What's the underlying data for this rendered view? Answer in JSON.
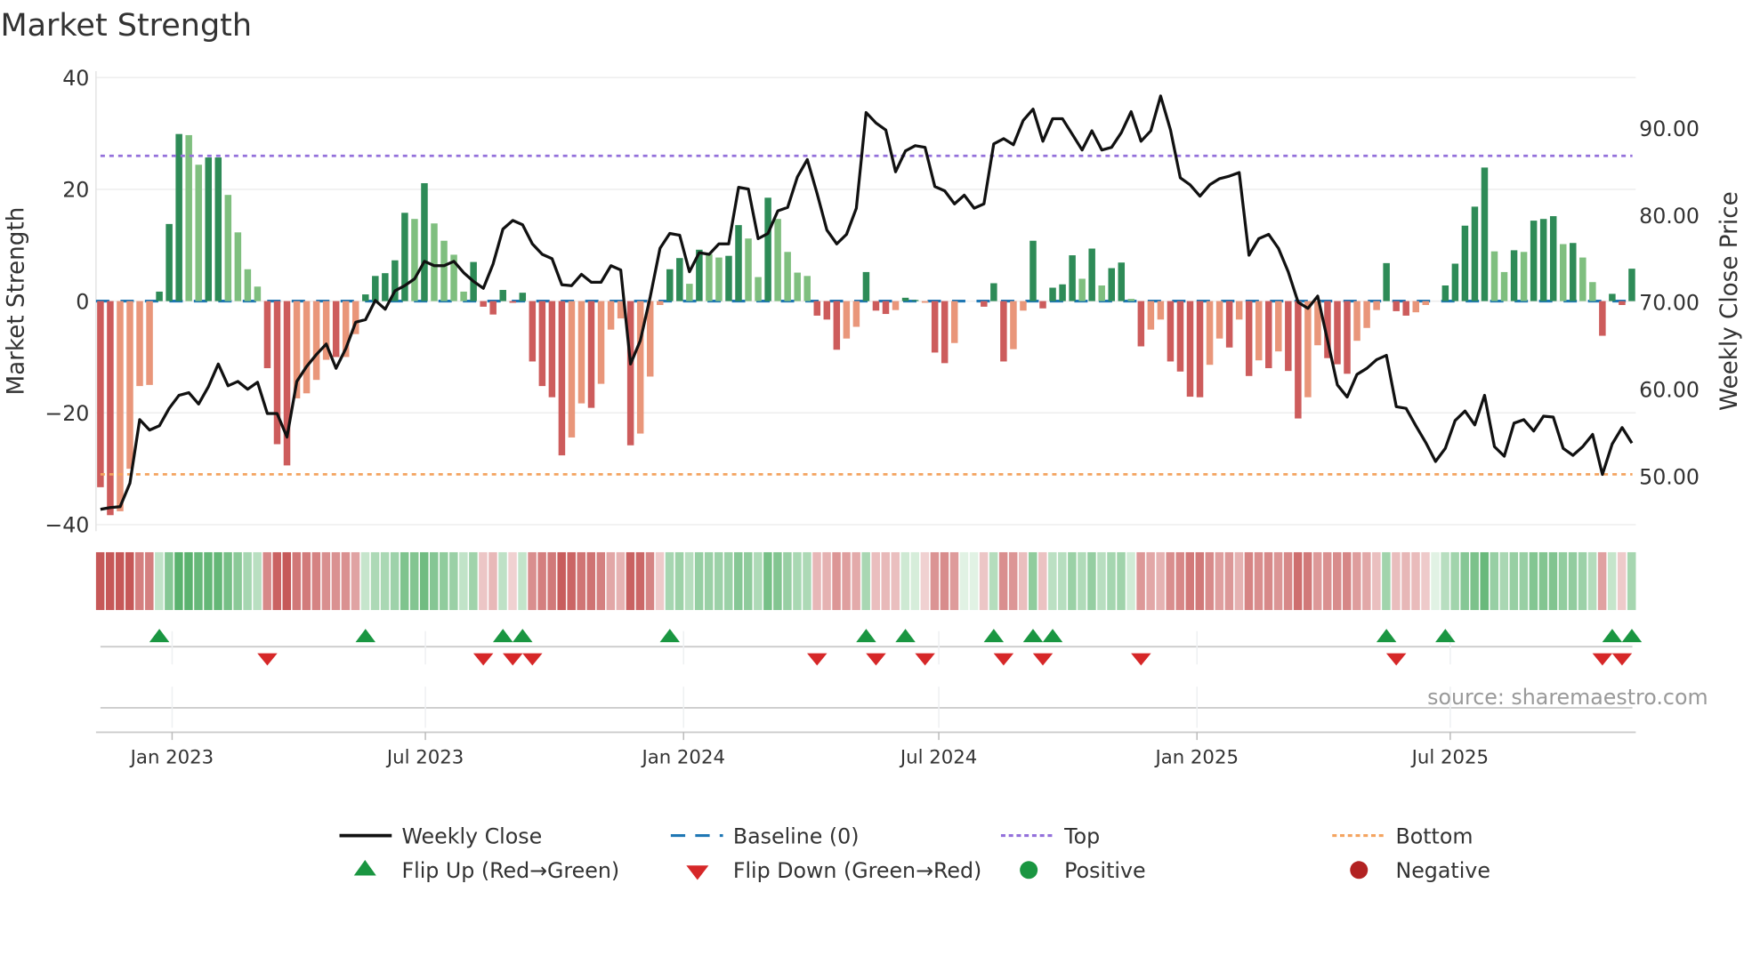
{
  "chart_data": {
    "type": "bar+line",
    "title": "Market Strength",
    "ylabel": "Market Strength",
    "y2label": "Weekly Close Price",
    "ylim": [
      -40,
      40
    ],
    "y2lim": [
      44.2,
      95.3
    ],
    "yticks": [
      "40",
      "20",
      "0",
      "−20",
      "−40"
    ],
    "ytick_values": [
      40,
      20,
      0,
      -20,
      -40
    ],
    "y2ticks": [
      "90.00",
      "80.00",
      "70.00",
      "60.00",
      "50.00"
    ],
    "y2tick_values": [
      90,
      80,
      70,
      60,
      50
    ],
    "x_ticks": [
      {
        "label": "Jan 2023",
        "week": 8.3
      },
      {
        "label": "Jul 2023",
        "week": 34.1
      },
      {
        "label": "Jan 2024",
        "week": 60.4
      },
      {
        "label": "Jul 2024",
        "week": 86.4
      },
      {
        "label": "Jan 2025",
        "week": 112.7
      },
      {
        "label": "Jul 2025",
        "week": 138.5
      }
    ],
    "top_level": 26,
    "bottom_level": -31,
    "baseline": 0,
    "strength": [
      -33.3,
      -38.3,
      -37.6,
      -30,
      -15.2,
      -15,
      1.7,
      13.8,
      29.9,
      29.7,
      24.4,
      25.7,
      25.7,
      19,
      12.3,
      5.7,
      2.6,
      -12,
      -25.6,
      -29.4,
      -17.4,
      -16.5,
      -14.1,
      -10.5,
      -10,
      -10,
      -5.9,
      1.2,
      4.5,
      5,
      7.3,
      15.8,
      14.7,
      21.1,
      13.9,
      10.8,
      8.3,
      1.7,
      7,
      -1,
      -2.4,
      2,
      -0.3,
      1.5,
      -10.8,
      -15.2,
      -17.2,
      -27.6,
      -24.4,
      -18.3,
      -19.1,
      -14.8,
      -5.1,
      -3.1,
      -25.8,
      -23.7,
      -13.5,
      -0.7,
      5.7,
      7.7,
      3.1,
      9.2,
      8.4,
      7.8,
      8.1,
      13.6,
      11.2,
      4.3,
      18.5,
      14.7,
      8.8,
      5.1,
      4.5,
      -2.6,
      -3.3,
      -8.7,
      -6.7,
      -4.6,
      5.2,
      -1.7,
      -2.3,
      -1.6,
      0.6,
      0.2,
      -0.3,
      -9.2,
      -11.1,
      -7.5,
      0,
      0,
      -1,
      3.2,
      -10.8,
      -8.6,
      -1.7,
      10.8,
      -1.3,
      2.4,
      3,
      8.2,
      4,
      9.4,
      2.8,
      5.9,
      6.9,
      0.4,
      -8.1,
      -5.1,
      -3.3,
      -10.8,
      -12.6,
      -17.1,
      -17.2,
      -11.4,
      -6.7,
      -8.3,
      -3.3,
      -13.4,
      -10.6,
      -12,
      -9,
      -12.5,
      -21,
      -17.2,
      -7.9,
      -10.2,
      -11.3,
      -13,
      -7.1,
      -4.8,
      -1.6,
      6.8,
      -1.8,
      -2.6,
      -2,
      -0.7,
      0,
      2.8,
      6.7,
      13.5,
      16.9,
      23.9,
      8.9,
      5.2,
      9.1,
      8.8,
      14.4,
      14.7,
      15.2,
      10.2,
      10.4,
      7.8,
      3.4,
      -6.2,
      1.3,
      -0.7,
      5.8
    ],
    "shade": "DDLLLLDDDLLDDLLLLDDDLLLLDLLDDDDDLDLLLLDDDDDDDDDDLLDLLLDLLLDDLDLLDDLLDLLLLDDDLLDDDLDDLDDLDDDDDLLDDDDDLDLDDLDLLDDDDLLDLDLDLDDLLDDDLLLDDDLLDDDDDDLLDLDDDLDLLDDDD",
    "weekly_close": [
      46.2,
      46.4,
      46.5,
      49.2,
      56.5,
      55.3,
      55.8,
      57.8,
      59.3,
      59.6,
      58.3,
      60.3,
      62.9,
      60.4,
      60.9,
      60,
      60.8,
      57.2,
      57.2,
      54.5,
      60.9,
      62.6,
      64,
      65.2,
      62.4,
      64.7,
      67.7,
      68,
      70.2,
      69.2,
      71.3,
      71.9,
      72.7,
      74.7,
      74.2,
      74.2,
      74.7,
      73.4,
      72.4,
      71.6,
      74.4,
      78.4,
      79.4,
      78.9,
      76.7,
      75.5,
      75,
      72,
      71.9,
      73.2,
      72.3,
      72.3,
      74.2,
      73.7,
      62.9,
      65.6,
      70.6,
      76.2,
      77.9,
      77.7,
      73.5,
      75.7,
      75.5,
      76.7,
      76.7,
      83.2,
      83,
      77.3,
      77.9,
      80.5,
      80.9,
      84.4,
      86.4,
      82.5,
      78.3,
      76.7,
      77.8,
      80.8,
      91.8,
      90.6,
      89.8,
      85,
      87.4,
      88,
      87.8,
      83.3,
      82.8,
      81.3,
      82.3,
      80.8,
      81.3,
      88.2,
      88.8,
      88.1,
      90.9,
      92.2,
      88.5,
      91.1,
      91.1,
      89.3,
      87.5,
      89.7,
      87.5,
      87.8,
      89.5,
      91.9,
      88.5,
      89.7,
      93.7,
      89.8,
      84.3,
      83.5,
      82.2,
      83.5,
      84.2,
      84.5,
      84.9,
      75.4,
      77.3,
      77.8,
      76.2,
      73.5,
      70,
      69.3,
      70.7,
      65.6,
      60.5,
      59.1,
      61.7,
      62.4,
      63.4,
      63.9,
      58,
      57.8,
      55.8,
      53.9,
      51.7,
      53.2,
      56.4,
      57.5,
      55.9,
      59.3,
      53.4,
      52.3,
      56.1,
      56.5,
      55.2,
      56.9,
      56.8,
      53.2,
      52.4,
      53.4,
      54.8,
      50.2,
      53.7,
      55.6,
      53.8
    ],
    "flip_up_weeks": [
      7,
      28,
      42,
      44,
      59,
      79,
      83,
      92,
      96,
      98,
      132,
      138,
      155,
      157
    ],
    "flip_down_weeks": [
      18,
      40,
      43,
      45,
      74,
      80,
      85,
      93,
      97,
      107,
      133,
      154,
      156
    ],
    "legend": {
      "weekly_close": "Weekly Close",
      "baseline": "Baseline (0)",
      "top": "Top",
      "bottom": "Bottom",
      "flip_up": "Flip Up (Red→Green)",
      "flip_down": "Flip Down (Green→Red)",
      "positive": "Positive",
      "negative": "Negative"
    },
    "legend_placement": "bottom",
    "grid": true,
    "source": "source: sharemaestro.com"
  },
  "colors": {
    "dark_green": "#2e8b57",
    "light_green": "#7fbf7f",
    "dark_red": "#cd5c5c",
    "light_red": "#e9967a",
    "baseline": "#1f77b4",
    "top": "#9370db",
    "bottom": "#f4a460",
    "flip_up": "#1a9641",
    "flip_down": "#d62728",
    "positive": "#1a9641",
    "negative": "#b22222"
  }
}
